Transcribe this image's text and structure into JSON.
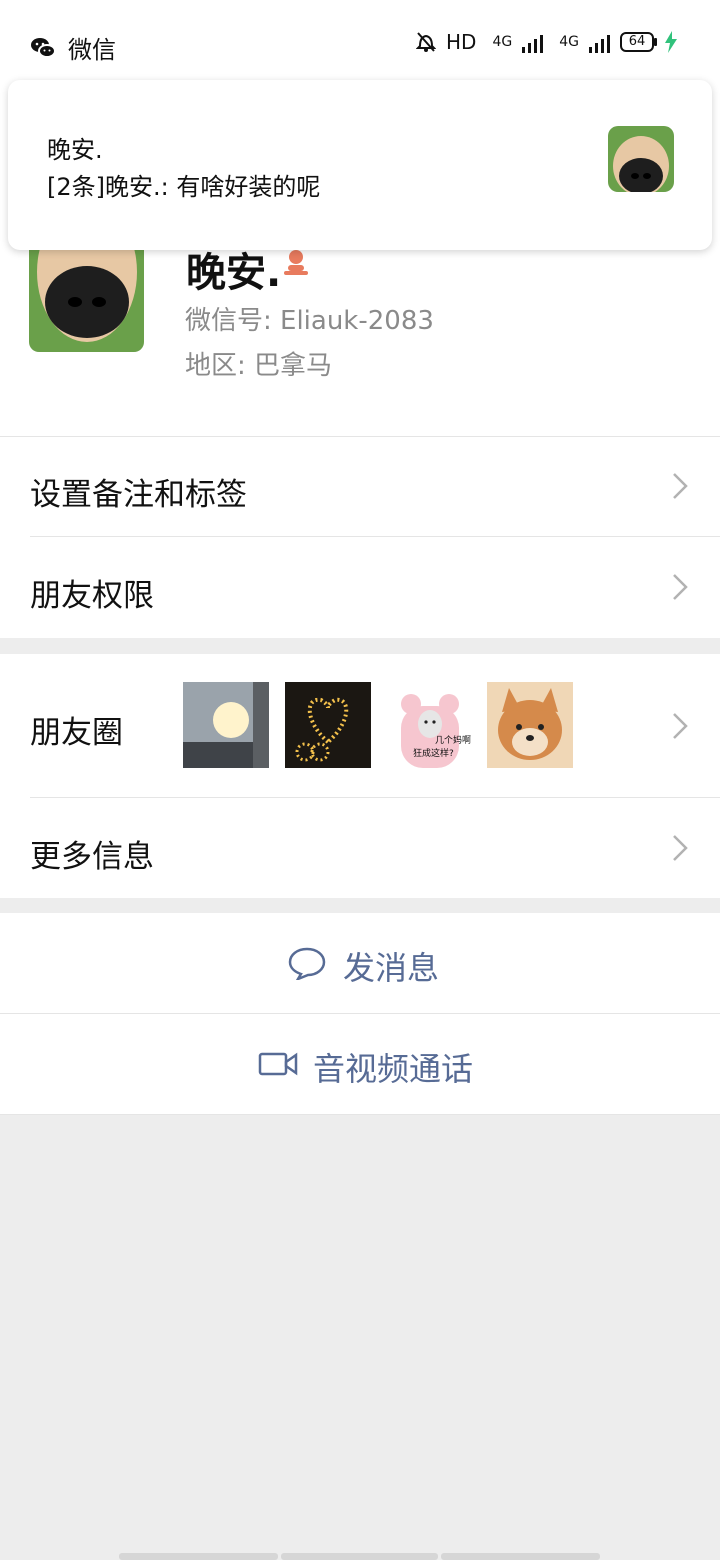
{
  "status_bar": {
    "app_name": "微信",
    "hd_label": "HD",
    "net_1": "4G",
    "net_2": "4G",
    "battery": "64"
  },
  "notification": {
    "title": "晚安.",
    "message": "[2条]晚安.: 有啥好装的呢"
  },
  "profile": {
    "display_name": "晚安.",
    "wechat_id": "微信号: Eliauk-2083",
    "region": "地区: 巴拿马"
  },
  "menu": {
    "remark_tags": "设置备注和标签",
    "friend_permissions": "朋友权限",
    "moments": "朋友圈",
    "more_info": "更多信息"
  },
  "moments_meme_text_1": "几个妈啊",
  "moments_meme_text_2": "狂成这样?",
  "actions": {
    "send_message": "发消息",
    "av_call": "音视频通话"
  },
  "colors": {
    "link_blue": "#576b95",
    "gender_icon": "#e87b5e",
    "background_gray": "#ededed"
  }
}
